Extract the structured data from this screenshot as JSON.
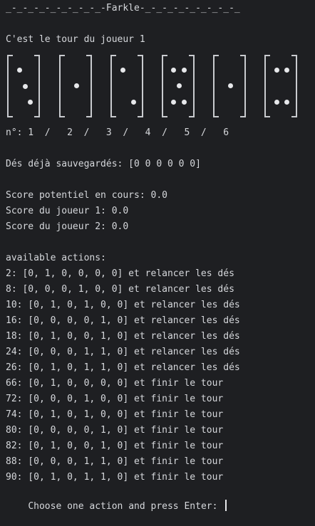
{
  "header": {
    "title": "_-_-_-_-_-_-_-_-_-Farkle-_-_-_-_-_-_-_-_-_"
  },
  "turn_text": "C'est le tour du joueur 1",
  "dice": [
    {
      "value": 3,
      "index_label": "1"
    },
    {
      "value": 1,
      "index_label": "2"
    },
    {
      "value": 2,
      "index_label": "3"
    },
    {
      "value": 5,
      "index_label": "4"
    },
    {
      "value": 1,
      "index_label": "5"
    },
    {
      "value": 4,
      "index_label": "6"
    }
  ],
  "dice_numbers_line": "n°: 1  /   2  /   3  /   4  /   5  /   6",
  "saved_dice_text": "Dés déjà sauvegardés: [0 0 0 0 0 0]",
  "scores": {
    "potential": "Score potentiel en cours: 0.0",
    "player1": "Score du joueur 1: 0.0",
    "player2": "Score du joueur 2: 0.0"
  },
  "actions_header": "available actions:",
  "actions": [
    "2: [0, 1, 0, 0, 0, 0] et relancer les dés",
    "8: [0, 0, 0, 1, 0, 0] et relancer les dés",
    "10: [0, 1, 0, 1, 0, 0] et relancer les dés",
    "16: [0, 0, 0, 0, 1, 0] et relancer les dés",
    "18: [0, 1, 0, 0, 1, 0] et relancer les dés",
    "24: [0, 0, 0, 1, 1, 0] et relancer les dés",
    "26: [0, 1, 0, 1, 1, 0] et relancer les dés",
    "66: [0, 1, 0, 0, 0, 0] et finir le tour",
    "72: [0, 0, 0, 1, 0, 0] et finir le tour",
    "74: [0, 1, 0, 1, 0, 0] et finir le tour",
    "80: [0, 0, 0, 0, 1, 0] et finir le tour",
    "82: [0, 1, 0, 0, 1, 0] et finir le tour",
    "88: [0, 0, 0, 1, 1, 0] et finir le tour",
    "90: [0, 1, 0, 1, 1, 0] et finir le tour"
  ],
  "prompt": "Choose one action and press Enter: ",
  "colors": {
    "background": "#1e1f22",
    "text": "#d6d8dc",
    "pip": "#e6e7ea"
  }
}
